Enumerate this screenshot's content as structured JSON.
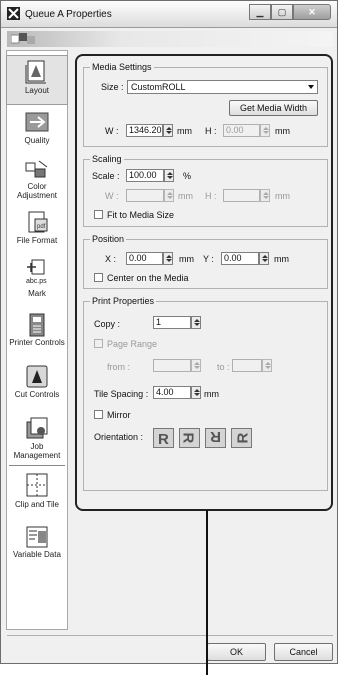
{
  "window": {
    "title": "Queue A Properties",
    "controls": [
      "minimize",
      "maximize",
      "close"
    ]
  },
  "sidebar": {
    "items": [
      {
        "label": "Layout",
        "icon": "layout-icon",
        "active": true
      },
      {
        "label": "Quality",
        "icon": "quality-icon"
      },
      {
        "label": "Color Adjustment",
        "icon": "color-adjustment-icon"
      },
      {
        "label": "File Format",
        "icon": "file-format-icon"
      },
      {
        "label": "Mark",
        "icon": "mark-icon",
        "icon_text": "abc.ps"
      },
      {
        "label": "Printer Controls",
        "icon": "printer-controls-icon"
      },
      {
        "label": "Cut Controls",
        "icon": "cut-controls-icon"
      },
      {
        "label": "Job Management",
        "icon": "job-management-icon"
      },
      {
        "label": "Clip and Tile",
        "icon": "clip-and-tile-icon"
      },
      {
        "label": "Variable Data",
        "icon": "variable-data-icon"
      }
    ]
  },
  "media": {
    "legend": "Media Settings",
    "size_label": "Size :",
    "size_value": "CustomROLL",
    "get_width_button": "Get Media Width",
    "w_label": "W :",
    "w_value": "1346.20",
    "w_unit": "mm",
    "h_label": "H :",
    "h_value": "0.00",
    "h_unit": "mm"
  },
  "scaling": {
    "legend": "Scaling",
    "scale_label": "Scale :",
    "scale_value": "100.00",
    "scale_unit": "%",
    "w_label": "W :",
    "w_unit": "mm",
    "h_label": "H :",
    "h_unit": "mm",
    "fit_label": "Fit to Media Size",
    "fit_checked": false
  },
  "position": {
    "legend": "Position",
    "x_label": "X :",
    "x_value": "0.00",
    "x_unit": "mm",
    "y_label": "Y :",
    "y_value": "0.00",
    "y_unit": "mm",
    "center_label": "Center on the Media",
    "center_checked": false
  },
  "print": {
    "legend": "Print Properties",
    "copy_label": "Copy :",
    "copy_value": "1",
    "page_range_label": "Page Range",
    "page_range_checked": false,
    "from_label": "from :",
    "to_label": "to :",
    "tile_label": "Tile Spacing :",
    "tile_value": "4.00",
    "tile_unit": "mm",
    "mirror_label": "Mirror",
    "mirror_checked": false,
    "orientation_label": "Orientation :",
    "orientations": [
      "rotate-0-icon",
      "rotate-90-icon",
      "rotate-180-icon",
      "rotate-270-icon"
    ]
  },
  "footer": {
    "ok": "OK",
    "cancel": "Cancel"
  }
}
